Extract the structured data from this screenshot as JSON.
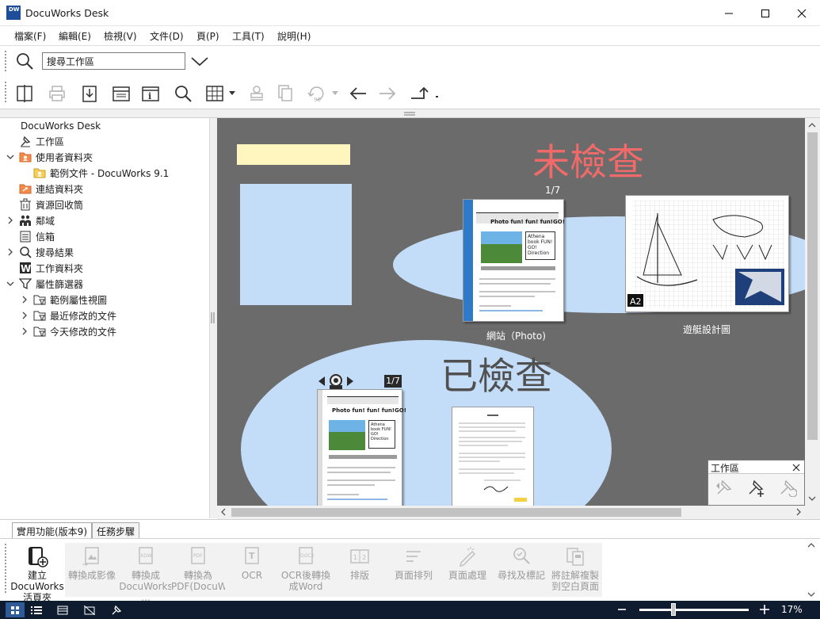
{
  "window": {
    "title": "DocuWorks Desk",
    "app_icon_text": "DW"
  },
  "menu": [
    "檔案(F)",
    "編輯(E)",
    "檢視(V)",
    "文件(D)",
    "頁(P)",
    "工具(T)",
    "說明(H)"
  ],
  "search": {
    "value": "搜尋工作區"
  },
  "tree": {
    "root": "DocuWorks Desk",
    "items": [
      {
        "label": "工作區"
      },
      {
        "label": "使用者資料夾"
      },
      {
        "label": "範例文件 - DocuWorks 9.1"
      },
      {
        "label": "連結資料夾"
      },
      {
        "label": "資源回收筒"
      },
      {
        "label": "鄰域"
      },
      {
        "label": "信箱"
      },
      {
        "label": "搜尋結果"
      },
      {
        "label": "工作資料夾"
      },
      {
        "label": "屬性篩選器"
      },
      {
        "label": "範例屬性視圖"
      },
      {
        "label": "最近修改的文件"
      },
      {
        "label": "今天修改的文件"
      }
    ]
  },
  "desk": {
    "unchecked_label": "未檢查",
    "checked_label": "已檢查",
    "doc_photo": {
      "name": "網站（Photo)",
      "page_badge": "1/7"
    },
    "doc_yacht": {
      "name": "遊艇設計圖",
      "size_badge": "A2"
    },
    "doc_checked": {
      "page_badge": "1/7"
    },
    "mini_doc_headline": "Photo fun! fun! fun!GO!",
    "mini_doc_side": "Athena book FUN! GO! Direction"
  },
  "workspace_panel": {
    "title": "工作區"
  },
  "bottom_tabs": [
    "實用功能(版本9)",
    "任務步驟"
  ],
  "ribbon": [
    {
      "label": "建立DocuWorks活頁夾"
    },
    {
      "label": "轉換成影像"
    },
    {
      "label": "轉換成 DocuWorks ..."
    },
    {
      "label": "轉換為 PDF(DocuWork..."
    },
    {
      "label": "OCR"
    },
    {
      "label": "OCR後轉換成Word"
    },
    {
      "label": "排版"
    },
    {
      "label": "頁面排列"
    },
    {
      "label": "頁面處理"
    },
    {
      "label": "尋找及標記"
    },
    {
      "label": "將註解複製到空白頁面"
    }
  ],
  "status": {
    "zoom": "17%",
    "zoom_level": 0.3
  },
  "colors": {
    "desk_bg": "#6b6b6b",
    "tray_blue": "#c3dcf7",
    "sticky_yellow": "#fff6bf",
    "unchecked_red": "#f06a6a",
    "checked_gray": "#505050",
    "status_bg": "#0f1b2e"
  }
}
